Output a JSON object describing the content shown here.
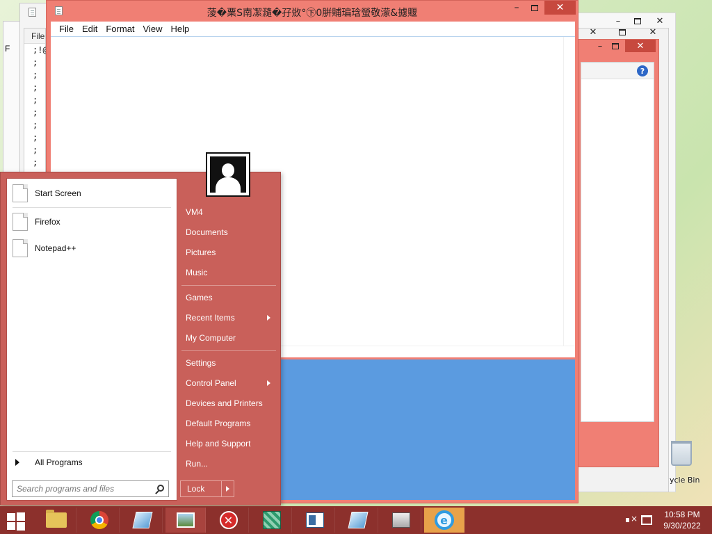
{
  "notepad": {
    "title": "蔆�䅇S南㓗瀡�孖敚°㊦0腁䝵㻞琀螢敬濛&攄䞁",
    "menu": [
      "File",
      "Edit",
      "Format",
      "View",
      "Help"
    ],
    "min_glyph": "–",
    "close_glyph": "✕"
  },
  "peek_window": {
    "menu_label": "File",
    "menu_label_short": "F",
    "lines": [
      ";!@",
      ";",
      ";",
      ";",
      ";",
      ";",
      ";",
      ";",
      ";",
      ";"
    ]
  },
  "background_window": {
    "min_glyph": "–",
    "close_glyph": "✕",
    "help_glyph": "?"
  },
  "recycle_bin": {
    "label": "ycle Bin"
  },
  "start_menu": {
    "pinned": [
      {
        "label": "Start Screen"
      },
      {
        "label": "Firefox"
      },
      {
        "label": "Notepad++"
      }
    ],
    "all_programs": "All Programs",
    "search_placeholder": "Search programs and files",
    "right_links": [
      {
        "label": "VM4",
        "submenu": false
      },
      {
        "label": "Documents",
        "submenu": false
      },
      {
        "label": "Pictures",
        "submenu": false
      },
      {
        "label": "Music",
        "submenu": false
      },
      {
        "label": "Games",
        "submenu": false
      },
      {
        "label": "Recent Items",
        "submenu": true
      },
      {
        "label": "My Computer",
        "submenu": false
      },
      {
        "label": "Settings",
        "submenu": false
      },
      {
        "label": "Control Panel",
        "submenu": true
      },
      {
        "label": "Devices and Printers",
        "submenu": false
      },
      {
        "label": "Default Programs",
        "submenu": false
      },
      {
        "label": "Help and Support",
        "submenu": false
      },
      {
        "label": "Run...",
        "submenu": false
      }
    ],
    "lock_label": "Lock"
  },
  "taskbar": {
    "apps": [
      {
        "icon": "file-explorer-icon"
      },
      {
        "icon": "chrome-icon"
      },
      {
        "icon": "glass-app-icon"
      },
      {
        "icon": "picture-viewer-icon",
        "active": true
      },
      {
        "icon": "error-app-icon"
      },
      {
        "icon": "cube-app-icon"
      },
      {
        "icon": "form-app-icon"
      },
      {
        "icon": "glass-app-icon"
      },
      {
        "icon": "monitor-app-icon"
      },
      {
        "icon": "internet-explorer-icon",
        "highlight": true
      }
    ],
    "clock_time": "10:58 PM",
    "clock_date": "9/30/2022"
  },
  "colors": {
    "window_frame": "#f07f74",
    "start_menu": "#c9605a",
    "taskbar": "#8c302c",
    "desktop_blue": "#5b9be0"
  }
}
